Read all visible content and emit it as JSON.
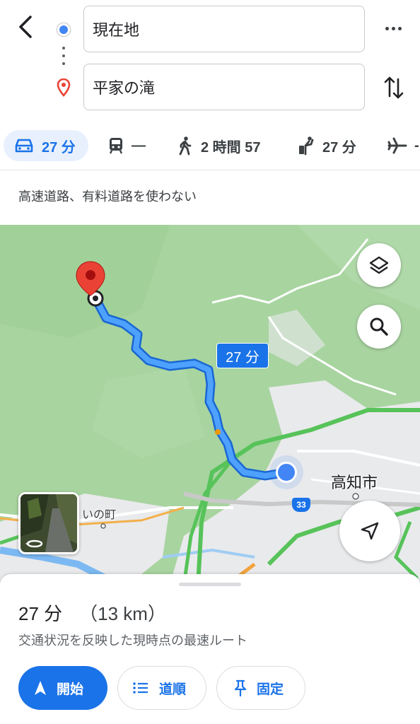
{
  "search": {
    "origin": "現在地",
    "destination": "平家の滝"
  },
  "modes": [
    {
      "name": "car",
      "label": "27 分"
    },
    {
      "name": "transit",
      "label": "—"
    },
    {
      "name": "walk",
      "label": "2 時間 57"
    },
    {
      "name": "ride",
      "label": "27 分"
    },
    {
      "name": "flight",
      "label": "-"
    }
  ],
  "options": {
    "avoid": "高速道路、有料道路を使わない"
  },
  "map": {
    "route_time": "27 分",
    "city_label": "高知市",
    "town_label": "いの町",
    "route_number": "33"
  },
  "sheet": {
    "duration": "27 分",
    "distance": "（13 km）",
    "description": "交通状況を反映した現時点の最速ルート",
    "start_label": "開始",
    "steps_label": "道順",
    "pin_label": "固定"
  },
  "colors": {
    "accent": "#1a73e8",
    "route": "#4285f4",
    "pin": "#ea4335",
    "park": "#a8d4a0",
    "highway": "#57c35a"
  },
  "icons": [
    "back-arrow-icon",
    "more-vert-icon",
    "swap-icon",
    "car-icon",
    "train-icon",
    "walk-icon",
    "ride-icon",
    "flight-icon",
    "layers-icon",
    "search-icon",
    "navigation-icon",
    "street-view-icon",
    "list-icon",
    "pin-icon"
  ]
}
